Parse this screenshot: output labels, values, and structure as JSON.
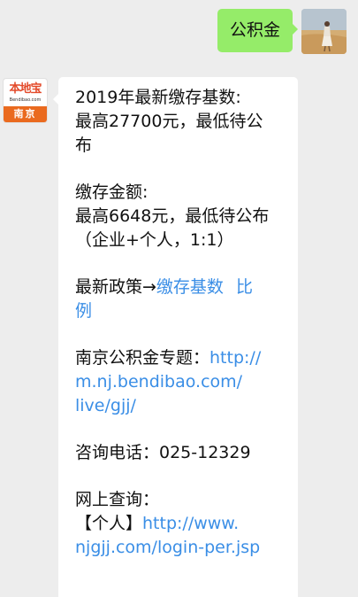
{
  "outgoing": {
    "text": "公积金"
  },
  "incoming": {
    "avatar": {
      "logo_text": "本地宝",
      "domain_text": "Bendibao.com",
      "city": "南京"
    },
    "base": {
      "label": "2019年最新缴存基数:",
      "line2": "最高27700元，最低待公",
      "line3": "布"
    },
    "amount": {
      "label": "缴存金额:",
      "line2": "最高6648元，最低待公布",
      "line3": "（企业+个人，1:1）"
    },
    "policy": {
      "label": "最新政策→",
      "link1": "缴存基数",
      "link2_part1": "比",
      "link2_part2": "例"
    },
    "topic": {
      "label": "南京公积金专题：",
      "link_part1": "http://",
      "link_part2": "m.nj.bendibao.com/",
      "link_part3": "live/gjj/"
    },
    "phone": {
      "text": "咨询电话：025-12329"
    },
    "query": {
      "label": "网上查询：",
      "personal_label": "【个人】",
      "link_part1": "http://www.",
      "link_part2": "njgjj.com/login-per.jsp"
    }
  },
  "colors": {
    "chat_background": "#ededed",
    "outgoing_bubble": "#95ec69",
    "incoming_bubble": "#ffffff",
    "link": "#3a8ee6",
    "avatar_orange": "#ea6a1f"
  }
}
